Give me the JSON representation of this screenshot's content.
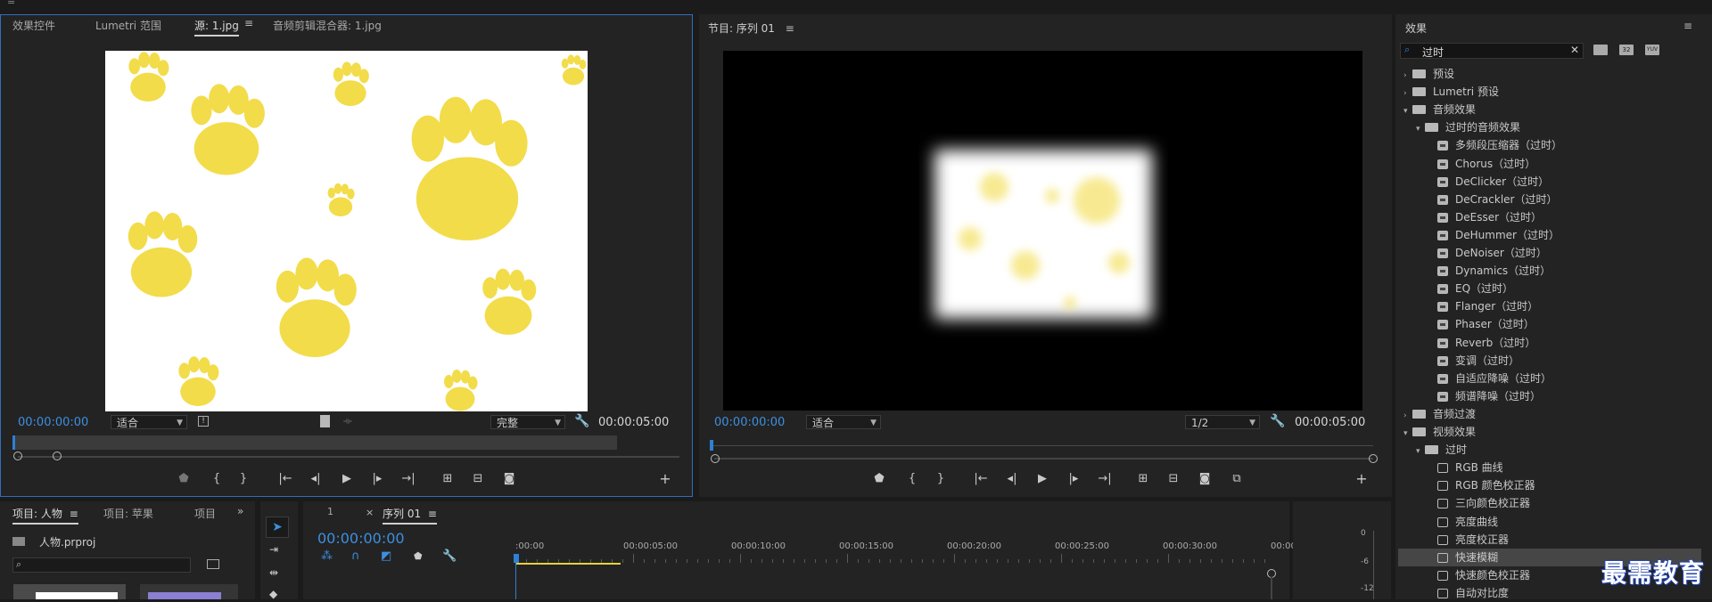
{
  "source_panel": {
    "tabs": [
      "效果控件",
      "Lumetri 范围",
      "源: 1.jpg",
      "音频剪辑混合器: 1.jpg"
    ],
    "active_tab": 2,
    "timecode_in": "00:00:00:00",
    "fit_select": "适合",
    "quality_select": "完整",
    "timecode_out": "00:00:05:00"
  },
  "program_panel": {
    "title": "节目: 序列 01",
    "timecode_in": "00:00:00:00",
    "fit_select": "适合",
    "resolution_select": "1/2",
    "timecode_out": "00:00:05:00"
  },
  "effects_panel": {
    "title": "效果",
    "search_value": "过时",
    "items": [
      {
        "label": "预设",
        "kind": "folder",
        "level": 0,
        "open": false
      },
      {
        "label": "Lumetri 预设",
        "kind": "folder",
        "level": 0,
        "open": false
      },
      {
        "label": "音频效果",
        "kind": "folder",
        "level": 0,
        "open": true
      },
      {
        "label": "过时的音频效果",
        "kind": "folder",
        "level": 1,
        "open": true
      },
      {
        "label": "多频段压缩器（过时）",
        "kind": "audio",
        "level": 2
      },
      {
        "label": "Chorus（过时）",
        "kind": "audio",
        "level": 2
      },
      {
        "label": "DeClicker（过时）",
        "kind": "audio",
        "level": 2
      },
      {
        "label": "DeCrackler（过时）",
        "kind": "audio",
        "level": 2
      },
      {
        "label": "DeEsser（过时）",
        "kind": "audio",
        "level": 2
      },
      {
        "label": "DeHummer（过时）",
        "kind": "audio",
        "level": 2
      },
      {
        "label": "DeNoiser（过时）",
        "kind": "audio",
        "level": 2
      },
      {
        "label": "Dynamics（过时）",
        "kind": "audio",
        "level": 2
      },
      {
        "label": "EQ（过时）",
        "kind": "audio",
        "level": 2
      },
      {
        "label": "Flanger（过时）",
        "kind": "audio",
        "level": 2
      },
      {
        "label": "Phaser（过时）",
        "kind": "audio",
        "level": 2
      },
      {
        "label": "Reverb（过时）",
        "kind": "audio",
        "level": 2
      },
      {
        "label": "变调（过时）",
        "kind": "audio",
        "level": 2
      },
      {
        "label": "自适应降噪（过时）",
        "kind": "audio",
        "level": 2
      },
      {
        "label": "频谱降噪（过时）",
        "kind": "audio",
        "level": 2
      },
      {
        "label": "音频过渡",
        "kind": "folder",
        "level": 0,
        "open": false
      },
      {
        "label": "视频效果",
        "kind": "folder",
        "level": 0,
        "open": true
      },
      {
        "label": "过时",
        "kind": "folder",
        "level": 1,
        "open": true
      },
      {
        "label": "RGB 曲线",
        "kind": "video",
        "level": 2
      },
      {
        "label": "RGB 颜色校正器",
        "kind": "video",
        "level": 2
      },
      {
        "label": "三向颜色校正器",
        "kind": "video",
        "level": 2
      },
      {
        "label": "亮度曲线",
        "kind": "video",
        "level": 2
      },
      {
        "label": "亮度校正器",
        "kind": "video",
        "level": 2
      },
      {
        "label": "快速模糊",
        "kind": "video",
        "level": 2,
        "selected": true
      },
      {
        "label": "快速颜色校正器",
        "kind": "video",
        "level": 2
      },
      {
        "label": "自动对比度",
        "kind": "video",
        "level": 2
      }
    ]
  },
  "project_panel": {
    "tabs": [
      "项目: 人物",
      "项目: 苹果",
      "项目"
    ],
    "file_name": "人物.prproj"
  },
  "timeline_panel": {
    "tabs": [
      "1",
      "序列 01"
    ],
    "timecode": "00:00:00:00",
    "ruler_labels": [
      ":00:00",
      "00:00:05:00",
      "00:00:10:00",
      "00:00:15:00",
      "00:00:20:00",
      "00:00:25:00",
      "00:00:30:00",
      "00:00"
    ]
  },
  "audio_meter": {
    "labels": [
      "0",
      "-6",
      "-12"
    ]
  },
  "watermark": "最需教育",
  "colors": {
    "accent_blue": "#3d8fe0",
    "paw_yellow": "#f2dc4a",
    "panel_bg": "#232323"
  }
}
